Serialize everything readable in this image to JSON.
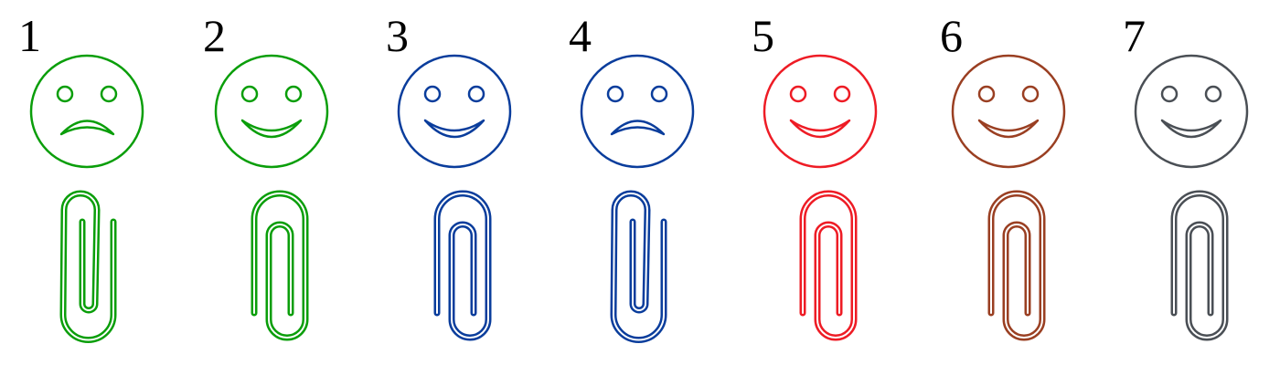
{
  "items": [
    {
      "number": "1",
      "face": "sad",
      "color": "#0a9e0a",
      "clip": "wire-right"
    },
    {
      "number": "2",
      "face": "happy",
      "color": "#0a9e0a",
      "clip": "wire-left"
    },
    {
      "number": "3",
      "face": "happy",
      "color": "#0a3d9c",
      "clip": "wire-left"
    },
    {
      "number": "4",
      "face": "sad",
      "color": "#0a3d9c",
      "clip": "wire-right"
    },
    {
      "number": "5",
      "face": "happy",
      "color": "#ee1c25",
      "clip": "wire-left"
    },
    {
      "number": "6",
      "face": "happy",
      "color": "#9a3f22",
      "clip": "wire-left"
    },
    {
      "number": "7",
      "face": "happy",
      "color": "#4a4f55",
      "clip": "wire-left"
    }
  ]
}
